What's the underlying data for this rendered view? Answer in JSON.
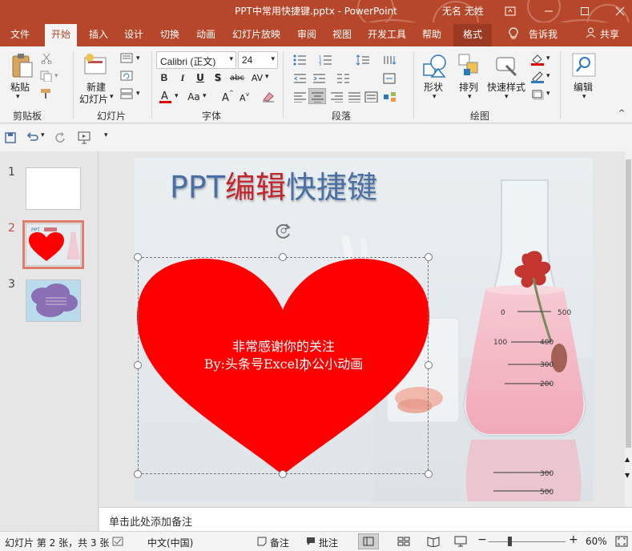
{
  "window": {
    "title": "PPT中常用快捷键.pptx  -  PowerPoint",
    "user": "无名 无姓"
  },
  "tabs": [
    "文件",
    "开始",
    "插入",
    "设计",
    "切换",
    "动画",
    "幻灯片放映",
    "审阅",
    "视图",
    "开发工具",
    "帮助",
    "格式"
  ],
  "active_tab": "开始",
  "tell_me": "告诉我",
  "share": "共享",
  "ribbon": {
    "clipboard": {
      "paste": "粘贴",
      "label": "剪贴板"
    },
    "slides": {
      "new_slide_line1": "新建",
      "new_slide_line2": "幻灯片",
      "label": "幻灯片"
    },
    "font": {
      "name": "Calibri (正文)",
      "size": "24",
      "label": "字体",
      "bold": "B",
      "italic": "I",
      "underline": "U",
      "shadow": "S",
      "strike": "abc",
      "spacing": "AV",
      "case": "Aa"
    },
    "paragraph": {
      "label": "段落"
    },
    "drawing": {
      "shapes": "形状",
      "arrange": "排列",
      "quick_styles": "快速样式",
      "label": "绘图"
    },
    "editing": {
      "label": "编辑"
    }
  },
  "slides_panel": {
    "thumbnails": [
      {
        "number": "1"
      },
      {
        "number": "2"
      },
      {
        "number": "3"
      }
    ],
    "selected": "2"
  },
  "slide": {
    "title_part1": "PPT",
    "title_part2": "编辑",
    "title_part3": "快捷键",
    "heart_line1": "非常感谢你的关注",
    "heart_line2": "By:头条号Excel办公小动画",
    "flask_marks": [
      "500",
      "400",
      "300",
      "200",
      "100",
      "0",
      "300",
      "500"
    ]
  },
  "notes": {
    "placeholder": "单击此处添加备注"
  },
  "status": {
    "slide_info": "幻灯片 第 2 张，共 3 张",
    "language": "中文(中国)",
    "notes": "备注",
    "comments": "批注",
    "zoom": "60%"
  },
  "colors": {
    "accent": "#b7472a",
    "heart": "#ff0000",
    "title_blue": "#4a6fa5",
    "title_red": "#c0262c"
  }
}
